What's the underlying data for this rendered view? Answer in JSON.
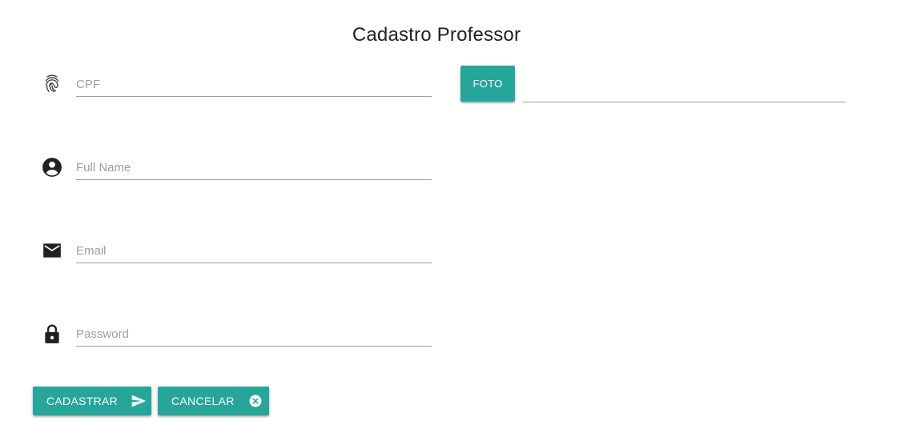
{
  "page": {
    "title": "Cadastro Professor"
  },
  "form": {
    "cpf": {
      "placeholder": "CPF",
      "value": "",
      "icon": "fingerprint-icon"
    },
    "full_name": {
      "placeholder": "Full Name",
      "value": "",
      "icon": "account-circle-icon"
    },
    "email": {
      "placeholder": "Email",
      "value": "",
      "icon": "mail-icon"
    },
    "password": {
      "placeholder": "Password",
      "value": "",
      "icon": "lock-icon"
    },
    "foto": {
      "label": "FOTO",
      "file_path": ""
    }
  },
  "actions": {
    "submit_label": "CADASTRAR",
    "submit_icon": "send-icon",
    "cancel_label": "CANCELAR",
    "cancel_icon": "cancel-icon"
  },
  "colors": {
    "accent": "#26a69a",
    "text": "#212121",
    "placeholder": "#9e9e9e",
    "underline": "#9e9e9e"
  }
}
